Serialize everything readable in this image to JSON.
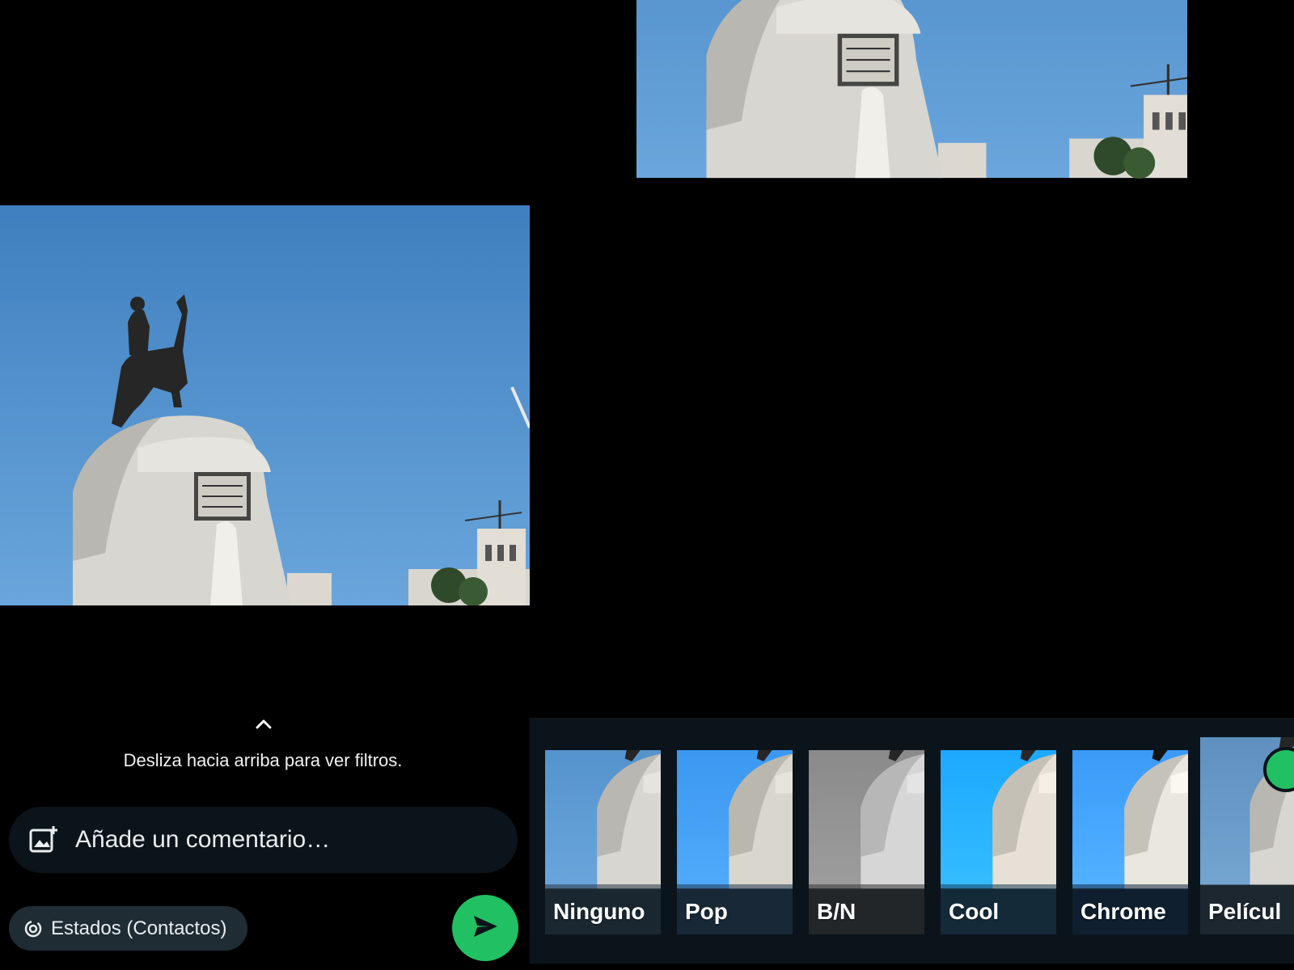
{
  "hint": {
    "text": "Desliza hacia arriba para ver filtros."
  },
  "comment": {
    "placeholder": "Añade un comentario…"
  },
  "status": {
    "label": "Estados (Contactos)"
  },
  "filters": [
    {
      "label": "Ninguno"
    },
    {
      "label": "Pop"
    },
    {
      "label": "B/N"
    },
    {
      "label": "Cool"
    },
    {
      "label": "Chrome"
    },
    {
      "label": "Películ"
    }
  ],
  "colors": {
    "accent": "#21c063",
    "panel": "#0b141a",
    "pill": "#1f2c34",
    "sky": "#4f8fcf"
  },
  "icons": {
    "chevron": "chevron-up-icon",
    "add_photo": "add-photo-icon",
    "status": "status-icon",
    "send": "send-icon",
    "check": "check-icon"
  }
}
